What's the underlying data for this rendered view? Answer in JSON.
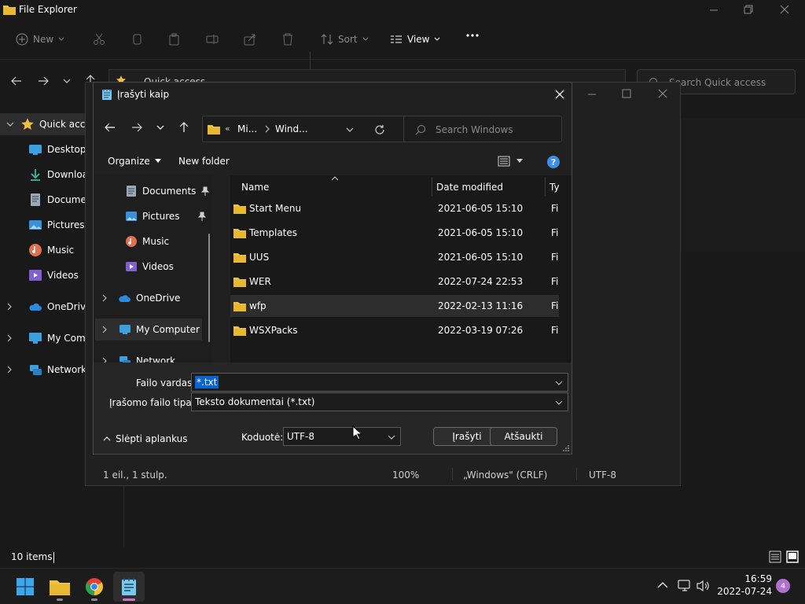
{
  "explorer": {
    "title": "File Explorer",
    "cmd": {
      "new": "New",
      "sort": "Sort",
      "view": "View"
    },
    "breadcrumb": "Quick access",
    "search_placeholder": "Search Quick access",
    "nav": {
      "quick_access": "Quick access",
      "desktop": "Desktop",
      "downloads": "Downloads",
      "documents": "Documents",
      "pictures": "Pictures",
      "music": "Music",
      "videos": "Videos",
      "onedrive": "OneDrive",
      "my_computer": "My Computer",
      "network": "Network"
    },
    "status_items": "10 items"
  },
  "notepad_status": {
    "position": "1 eil., 1 stulp.",
    "zoom": "100%",
    "line_ending": "„Windows\" (CRLF)",
    "encoding": "UTF-8"
  },
  "dialog": {
    "title": "Įrašyti kaip",
    "path": {
      "seg1": "Mi...",
      "seg2": "Wind..."
    },
    "search_placeholder": "Search Windows",
    "organize": "Organize",
    "new_folder": "New folder",
    "columns": {
      "name": "Name",
      "date": "Date modified",
      "type": "Ty"
    },
    "nav": {
      "documents": "Documents",
      "pictures": "Pictures",
      "music": "Music",
      "videos": "Videos",
      "onedrive": "OneDrive",
      "my_computer": "My Computer",
      "network": "Network"
    },
    "files": [
      {
        "name": "Start Menu",
        "date": "2021-06-05 15:10",
        "type": "Fi"
      },
      {
        "name": "Templates",
        "date": "2021-06-05 15:10",
        "type": "Fi"
      },
      {
        "name": "UUS",
        "date": "2021-06-05 15:10",
        "type": "Fi"
      },
      {
        "name": "WER",
        "date": "2022-07-24 22:53",
        "type": "Fi"
      },
      {
        "name": "wfp",
        "date": "2022-02-13 11:16",
        "type": "Fi"
      },
      {
        "name": "WSXPacks",
        "date": "2022-03-19 07:26",
        "type": "Fi"
      }
    ],
    "filename_label": "Failo vardas:",
    "filename_value": "*.txt",
    "filetype_label": "Įrašomo failo tipas:",
    "filetype_value": "Teksto dokumentai (*.txt)",
    "hide_folders": "Slėpti aplankus",
    "encoding_label": "Koduotė:",
    "encoding_value": "UTF-8",
    "save": "Įrašyti",
    "cancel": "Atšaukti"
  },
  "taskbar": {
    "time": "16:59",
    "date": "2022-07-24",
    "notifications": "4"
  },
  "colors": {
    "accent": "#0a64d0",
    "folder": "#f0c040",
    "help": "#3b8eea"
  }
}
